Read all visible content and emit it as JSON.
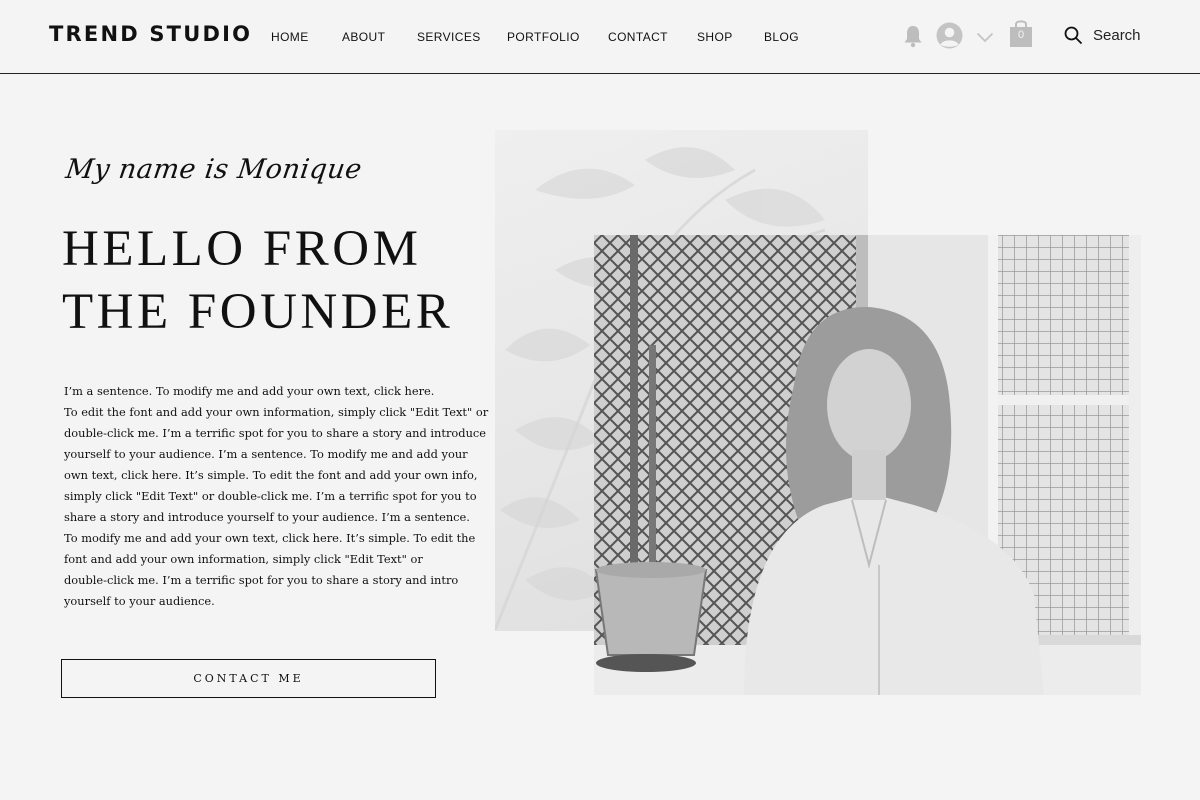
{
  "header": {
    "logo": "TREND STUDIO",
    "nav": [
      "HOME",
      "ABOUT",
      "SERVICES",
      "PORTFOLIO",
      "CONTACT",
      "SHOP",
      "BLOG"
    ],
    "cart_count": "0",
    "search_label": "Search",
    "icons": [
      "bell-icon",
      "avatar-icon",
      "chevron-down-icon",
      "shopping-bag-icon",
      "search-icon"
    ]
  },
  "hero": {
    "script_line": "My name is Monique",
    "headline": [
      "HELLO FROM",
      "THE FOUNDER"
    ],
    "body_lines": [
      "I’m a sentence. To modify me and add your own text, click here.",
      "To edit the font and add your own information, simply click \"Edit Text\" or",
      "double-click me. I’m a terrific spot for you to share a story and introduce",
      "yourself to your audience. I’m a sentence. To modify me and add your",
      "own text, click here. It’s simple. To edit the font and add your own info,",
      "simply click \"Edit Text\" or double-click me. I’m a terrific spot for you to",
      "share a story and introduce yourself to your audience. I’m a sentence.",
      "To modify me and add your own text, click here. It’s simple. To edit the",
      "font and add your own information, simply click \"Edit Text\" or",
      "double-click me. I’m a terrific spot for you to share a story and intro",
      "yourself to your audience."
    ],
    "cta_label": "CONTACT ME"
  },
  "colors": {
    "background": "#f4f4f4",
    "text": "#111111",
    "icon_gray": "#bdbdbd"
  }
}
